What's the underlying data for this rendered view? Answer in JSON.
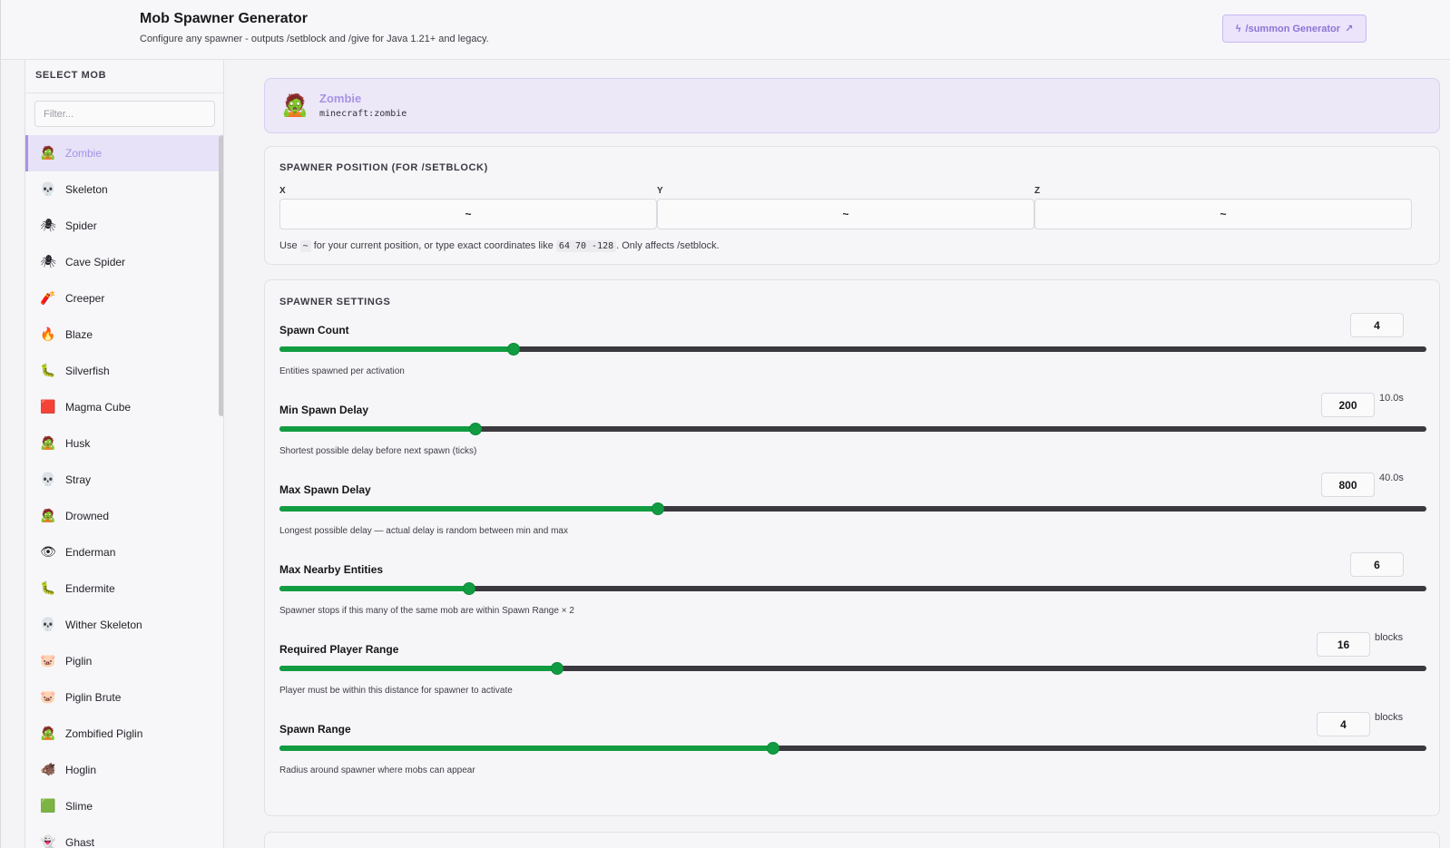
{
  "header": {
    "title": "Mob Spawner Generator",
    "subtitle": "Configure any spawner - outputs /setblock and /give for Java 1.21+ and legacy.",
    "summon_button": "/summon Generator",
    "summon_icon": "bolt-icon",
    "external_icon": "external-link-icon"
  },
  "sidebar": {
    "title": "SELECT MOB",
    "filter_placeholder": "Filter...",
    "items": [
      {
        "label": "Zombie",
        "icon": "🧟",
        "active": true
      },
      {
        "label": "Skeleton",
        "icon": "💀"
      },
      {
        "label": "Spider",
        "icon": "🕷"
      },
      {
        "label": "Cave Spider",
        "icon": "🕷"
      },
      {
        "label": "Creeper",
        "icon": "🧨"
      },
      {
        "label": "Blaze",
        "icon": "🔥"
      },
      {
        "label": "Silverfish",
        "icon": "🐛"
      },
      {
        "label": "Magma Cube",
        "icon": "🟥"
      },
      {
        "label": "Husk",
        "icon": "🧟"
      },
      {
        "label": "Stray",
        "icon": "💀"
      },
      {
        "label": "Drowned",
        "icon": "🧟"
      },
      {
        "label": "Enderman",
        "icon": "👁"
      },
      {
        "label": "Endermite",
        "icon": "🐛"
      },
      {
        "label": "Wither Skeleton",
        "icon": "💀"
      },
      {
        "label": "Piglin",
        "icon": "🐷"
      },
      {
        "label": "Piglin Brute",
        "icon": "🐷"
      },
      {
        "label": "Zombified Piglin",
        "icon": "🧟"
      },
      {
        "label": "Hoglin",
        "icon": "🐗"
      },
      {
        "label": "Slime",
        "icon": "🟩"
      },
      {
        "label": "Ghast",
        "icon": "👻"
      }
    ]
  },
  "selected_mob": {
    "name": "Zombie",
    "id": "minecraft:zombie",
    "icon": "🧟"
  },
  "position": {
    "title": "SPAWNER POSITION (FOR /SETBLOCK)",
    "x_label": "X",
    "y_label": "Y",
    "z_label": "Z",
    "x_value": "~",
    "y_value": "~",
    "z_value": "~",
    "hint_pre": "Use",
    "hint_tilde": "~",
    "hint_mid": "for your current position, or type exact coordinates like",
    "hint_example": "64 70 -128",
    "hint_post": ". Only affects /setblock."
  },
  "settings": {
    "title": "SPAWNER SETTINGS",
    "items": [
      {
        "label": "Spawn Count",
        "value": "4",
        "unit": "",
        "desc": "Entities spawned per activation",
        "fraction": 0.204
      },
      {
        "label": "Min Spawn Delay",
        "value": "200",
        "unit": "10.0s",
        "desc": "Shortest possible delay before next spawn (ticks)",
        "fraction": 0.171
      },
      {
        "label": "Max Spawn Delay",
        "value": "800",
        "unit": "40.0s",
        "desc": "Longest possible delay — actual delay is random between min and max",
        "fraction": 0.33
      },
      {
        "label": "Max Nearby Entities",
        "value": "6",
        "unit": "",
        "desc": "Spawner stops if this many of the same mob are within Spawn Range × 2",
        "fraction": 0.165
      },
      {
        "label": "Required Player Range",
        "value": "16",
        "unit": "blocks",
        "desc": "Player must be within this distance for spawner to activate",
        "fraction": 0.242
      },
      {
        "label": "Spawn Range",
        "value": "4",
        "unit": "blocks",
        "desc": "Radius around spawner where mobs can appear",
        "fraction": 0.43
      }
    ]
  }
}
